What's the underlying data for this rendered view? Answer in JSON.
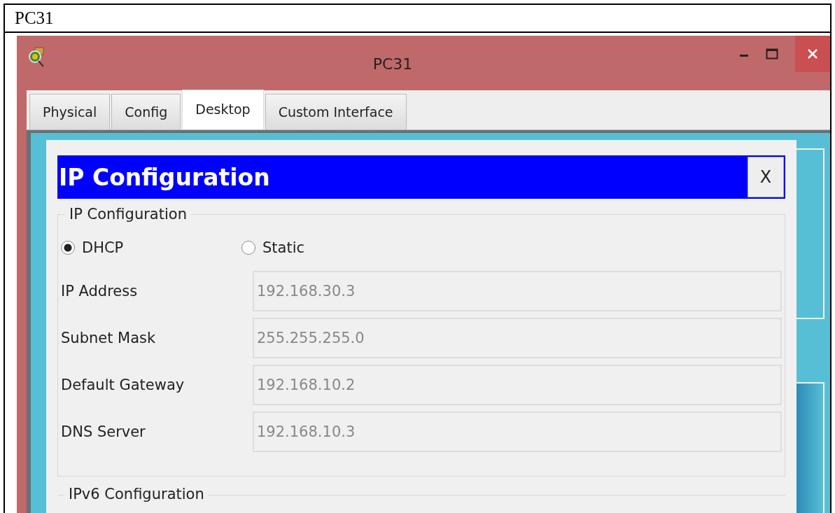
{
  "document_cell": {
    "caption": "PC31"
  },
  "window": {
    "title": "PC31"
  },
  "tabs": [
    {
      "label": "Physical",
      "selected": false
    },
    {
      "label": "Config",
      "selected": false
    },
    {
      "label": "Desktop",
      "selected": true
    },
    {
      "label": "Custom Interface",
      "selected": false
    }
  ],
  "dialog": {
    "title": "IP Configuration",
    "close_label": "X",
    "ip_section": {
      "legend": "IP Configuration",
      "modes": [
        {
          "label": "DHCP",
          "selected": true
        },
        {
          "label": "Static",
          "selected": false
        }
      ],
      "fields": [
        {
          "label": "IP Address",
          "value": "192.168.30.3",
          "disabled": true
        },
        {
          "label": "Subnet Mask",
          "value": "255.255.255.0",
          "disabled": true
        },
        {
          "label": "Default Gateway",
          "value": "192.168.10.2",
          "disabled": true
        },
        {
          "label": "DNS Server",
          "value": "192.168.10.3",
          "disabled": true
        }
      ]
    },
    "ipv6_section": {
      "legend": "IPv6 Configuration"
    }
  }
}
